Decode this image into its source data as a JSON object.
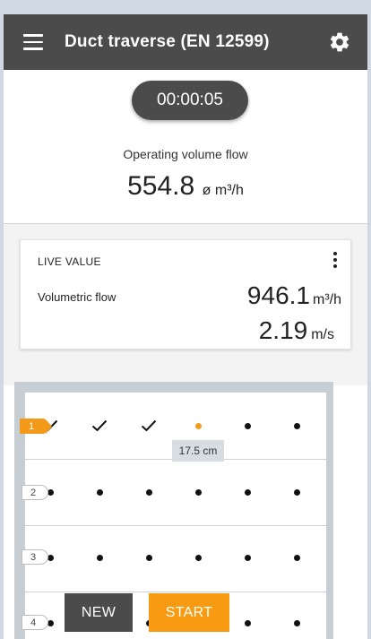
{
  "app": {
    "title": "Duct traverse (EN 12599)"
  },
  "summary": {
    "timer": "00:00:05",
    "operating_label": "Operating volume flow",
    "operating_value": "554.8",
    "operating_unit": "ø m³/h"
  },
  "live": {
    "title": "LIVE VALUE",
    "flow_label": "Volumetric flow",
    "flow_value": "946.1",
    "flow_unit": "m³/h",
    "velocity_value": "2.19",
    "velocity_unit": "m/s"
  },
  "traverse": {
    "rows": [
      {
        "label": "1",
        "points": [
          "check",
          "check",
          "check",
          "current",
          "pending",
          "pending"
        ]
      },
      {
        "label": "2",
        "points": [
          "pending",
          "pending",
          "pending",
          "pending",
          "pending",
          "pending"
        ]
      },
      {
        "label": "3",
        "points": [
          "pending",
          "pending",
          "pending",
          "pending",
          "pending",
          "pending"
        ]
      },
      {
        "label": "4",
        "points": [
          "pending",
          "pending",
          "pending",
          "pending",
          "pending",
          "pending"
        ]
      }
    ],
    "current_depth": "17.5 cm"
  },
  "actions": {
    "new_label": "NEW",
    "start_label": "START"
  },
  "colors": {
    "appbar": "#4b4b4b",
    "accent": "#f39a1b",
    "start_button": "#f99b12"
  }
}
